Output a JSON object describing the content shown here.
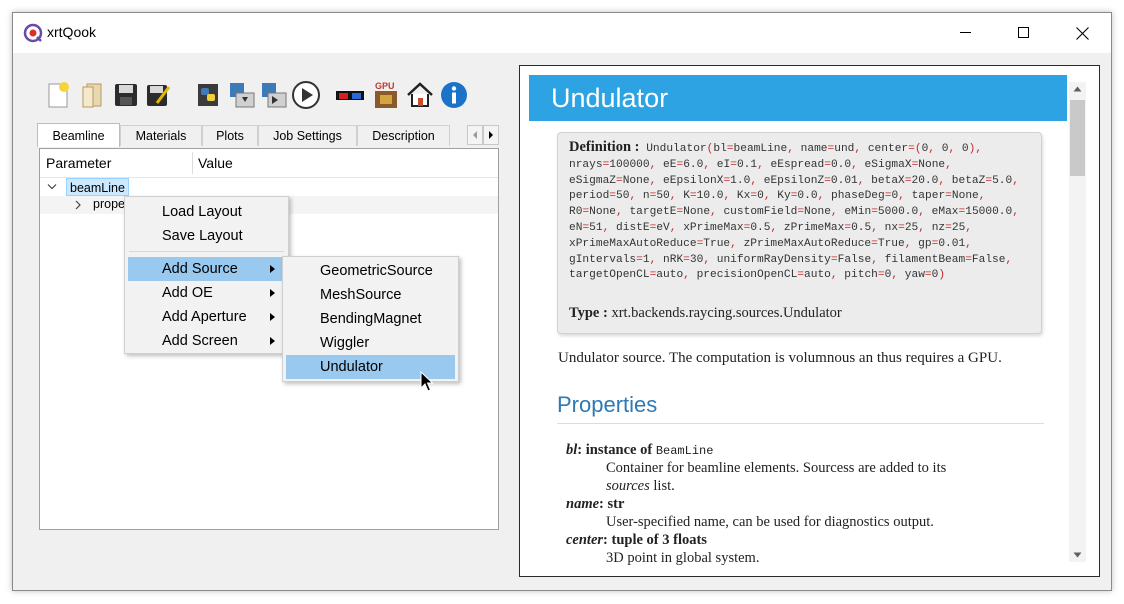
{
  "window": {
    "title": "xrtQook"
  },
  "toolbar": {
    "icons": [
      "new-layout-icon",
      "load-layout-icon",
      "save-layout-icon",
      "save-as-icon",
      "python-script-icon",
      "save-script-icon",
      "run-script-icon",
      "run-icon",
      "glasses-3d-icon",
      "gpu-icon",
      "home-icon",
      "info-icon"
    ]
  },
  "tabs": [
    "Beamline",
    "Materials",
    "Plots",
    "Job Settings",
    "Description"
  ],
  "tree": {
    "header_param": "Parameter",
    "header_value": "Value",
    "root": "beamLine",
    "child": "prope"
  },
  "context_menu": {
    "items": [
      "Load Layout",
      "Save Layout",
      "Add Source",
      "Add OE",
      "Add Aperture",
      "Add Screen"
    ]
  },
  "submenu": {
    "items": [
      "GeometricSource",
      "MeshSource",
      "BendingMagnet",
      "Wiggler",
      "Undulator"
    ],
    "highlighted": "Undulator"
  },
  "doc": {
    "title": "Undulator",
    "definition_label": "Definition :",
    "signature": "Undulator(bl=beamLine, name=und, center=(0, 0, 0), nrays=100000, eE=6.0, eI=0.1, eEspread=0.0, eSigmaX=None, eSigmaZ=None, eEpsilonX=1.0, eEpsilonZ=0.01, betaX=20.0, betaZ=5.0, period=50, n=50, K=10.0, Kx=0, Ky=0.0, phaseDeg=0, taper=None, R0=None, targetE=None, customField=None, eMin=5000.0, eMax=15000.0, eN=51, distE=eV, xPrimeMax=0.5, zPrimeMax=0.5, nx=25, nz=25, xPrimeMaxAutoReduce=True, zPrimeMaxAutoReduce=True, gp=0.01, gIntervals=1, nRK=30, uniformRayDensity=False, filamentBeam=False, targetOpenCL=auto, precisionOpenCL=auto, pitch=0, yaw=0)",
    "type_label": "Type :",
    "type_value": "xrt.backends.raycing.sources.Undulator",
    "description": "Undulator source. The computation is volumnous an thus requires a GPU.",
    "properties_heading": "Properties",
    "props": [
      {
        "name": "bl",
        "type_prefix": ": instance of ",
        "type_mono": "BeamLine",
        "desc1": "Container for beamline elements. Sourcess are added to its",
        "desc2_italic": "sources",
        "desc2_rest": " list."
      },
      {
        "name": "name",
        "type_prefix": ": str",
        "desc1": "User-specified name, can be used for diagnostics output."
      },
      {
        "name": "center",
        "type_prefix": ": tuple of 3 floats",
        "desc1": "3D point in global system."
      }
    ]
  },
  "colors": {
    "banner": "#2ea3e3",
    "menu_highlight": "#99c9ef",
    "tree_selection": "#cce8ff",
    "properties_heading": "#2e79b5"
  }
}
